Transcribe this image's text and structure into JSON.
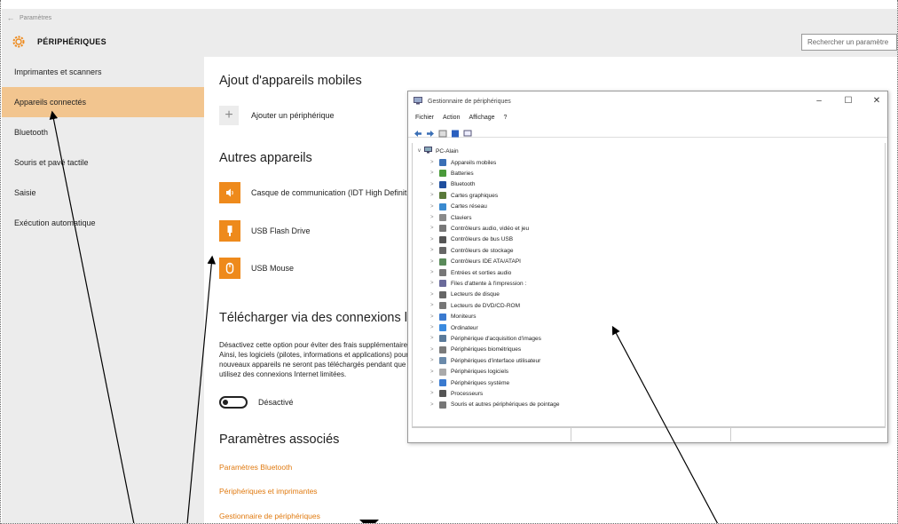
{
  "window": {
    "back": "←",
    "title": "Paramètres"
  },
  "header": {
    "title": "PÉRIPHÉRIQUES",
    "search_placeholder": "Rechercher un paramètre"
  },
  "nav": {
    "items": [
      {
        "label": "Imprimantes et scanners",
        "active": false
      },
      {
        "label": "Appareils connectés",
        "active": true
      },
      {
        "label": "Bluetooth",
        "active": false
      },
      {
        "label": "Souris et pavé tactile",
        "active": false
      },
      {
        "label": "Saisie",
        "active": false
      },
      {
        "label": "Exécution automatique",
        "active": false
      }
    ]
  },
  "main": {
    "add_section": {
      "title": "Ajout d'appareils mobiles",
      "add_label": "Ajouter un périphérique"
    },
    "other_section": {
      "title": "Autres appareils",
      "devices": [
        {
          "label": "Casque de communication (IDT High Definition Audio CODEC)",
          "icon": "speaker-icon"
        },
        {
          "label": "USB Flash Drive",
          "icon": "usb-drive-icon"
        },
        {
          "label": "USB Mouse",
          "icon": "mouse-icon"
        }
      ]
    },
    "download_section": {
      "title": "Télécharger via des connexions limitées",
      "lines": [
        "Désactivez cette option pour éviter des frais supplémentaires.",
        "Ainsi, les logiciels (pilotes, informations et applications) pour les",
        "nouveaux appareils ne seront pas téléchargés pendant que vous",
        "utilisez des connexions Internet limitées."
      ],
      "toggle_label": "Désactivé"
    },
    "related_section": {
      "title": "Paramètres associés",
      "links": [
        "Paramètres Bluetooth",
        "Périphériques et imprimantes",
        "Gestionnaire de périphériques"
      ]
    }
  },
  "device_manager": {
    "title": "Gestionnaire de périphériques",
    "controls": {
      "minimize": "–",
      "maximize": "☐",
      "close": "✕"
    },
    "menu": [
      "Fichier",
      "Action",
      "Affichage",
      "?"
    ],
    "root": "PC-Alain",
    "items": [
      {
        "label": "Appareils mobiles",
        "color": "#3a6fb5"
      },
      {
        "label": "Batteries",
        "color": "#4a9a3a"
      },
      {
        "label": "Bluetooth",
        "color": "#1f4f9e"
      },
      {
        "label": "Cartes graphiques",
        "color": "#5a7a3a"
      },
      {
        "label": "Cartes réseau",
        "color": "#3a8acf"
      },
      {
        "label": "Claviers",
        "color": "#8a8a8a"
      },
      {
        "label": "Contrôleurs audio, vidéo et jeu",
        "color": "#777"
      },
      {
        "label": "Contrôleurs de bus USB",
        "color": "#555"
      },
      {
        "label": "Contrôleurs de stockage",
        "color": "#666"
      },
      {
        "label": "Contrôleurs IDE ATA/ATAPI",
        "color": "#5a8a5a"
      },
      {
        "label": "Entrées et sorties audio",
        "color": "#777"
      },
      {
        "label": "Files d'attente à l'impression :",
        "color": "#6a6a9a"
      },
      {
        "label": "Lecteurs de disque",
        "color": "#666"
      },
      {
        "label": "Lecteurs de DVD/CD-ROM",
        "color": "#777"
      },
      {
        "label": "Moniteurs",
        "color": "#3a7acf"
      },
      {
        "label": "Ordinateur",
        "color": "#3a8adf"
      },
      {
        "label": "Périphérique d'acquisition d'images",
        "color": "#5a7a9a"
      },
      {
        "label": "Périphériques biométriques",
        "color": "#7a7a7a"
      },
      {
        "label": "Périphériques d'interface utilisateur",
        "color": "#6a8aaa"
      },
      {
        "label": "Périphériques logiciels",
        "color": "#aaa"
      },
      {
        "label": "Périphériques système",
        "color": "#3a7acf"
      },
      {
        "label": "Processeurs",
        "color": "#555"
      },
      {
        "label": "Souris et autres périphériques de pointage",
        "color": "#777"
      }
    ]
  },
  "colors": {
    "accent": "#ee8a1c",
    "link": "#e07a10",
    "nav_active": "#f2c58f",
    "chrome": "#ececec"
  }
}
